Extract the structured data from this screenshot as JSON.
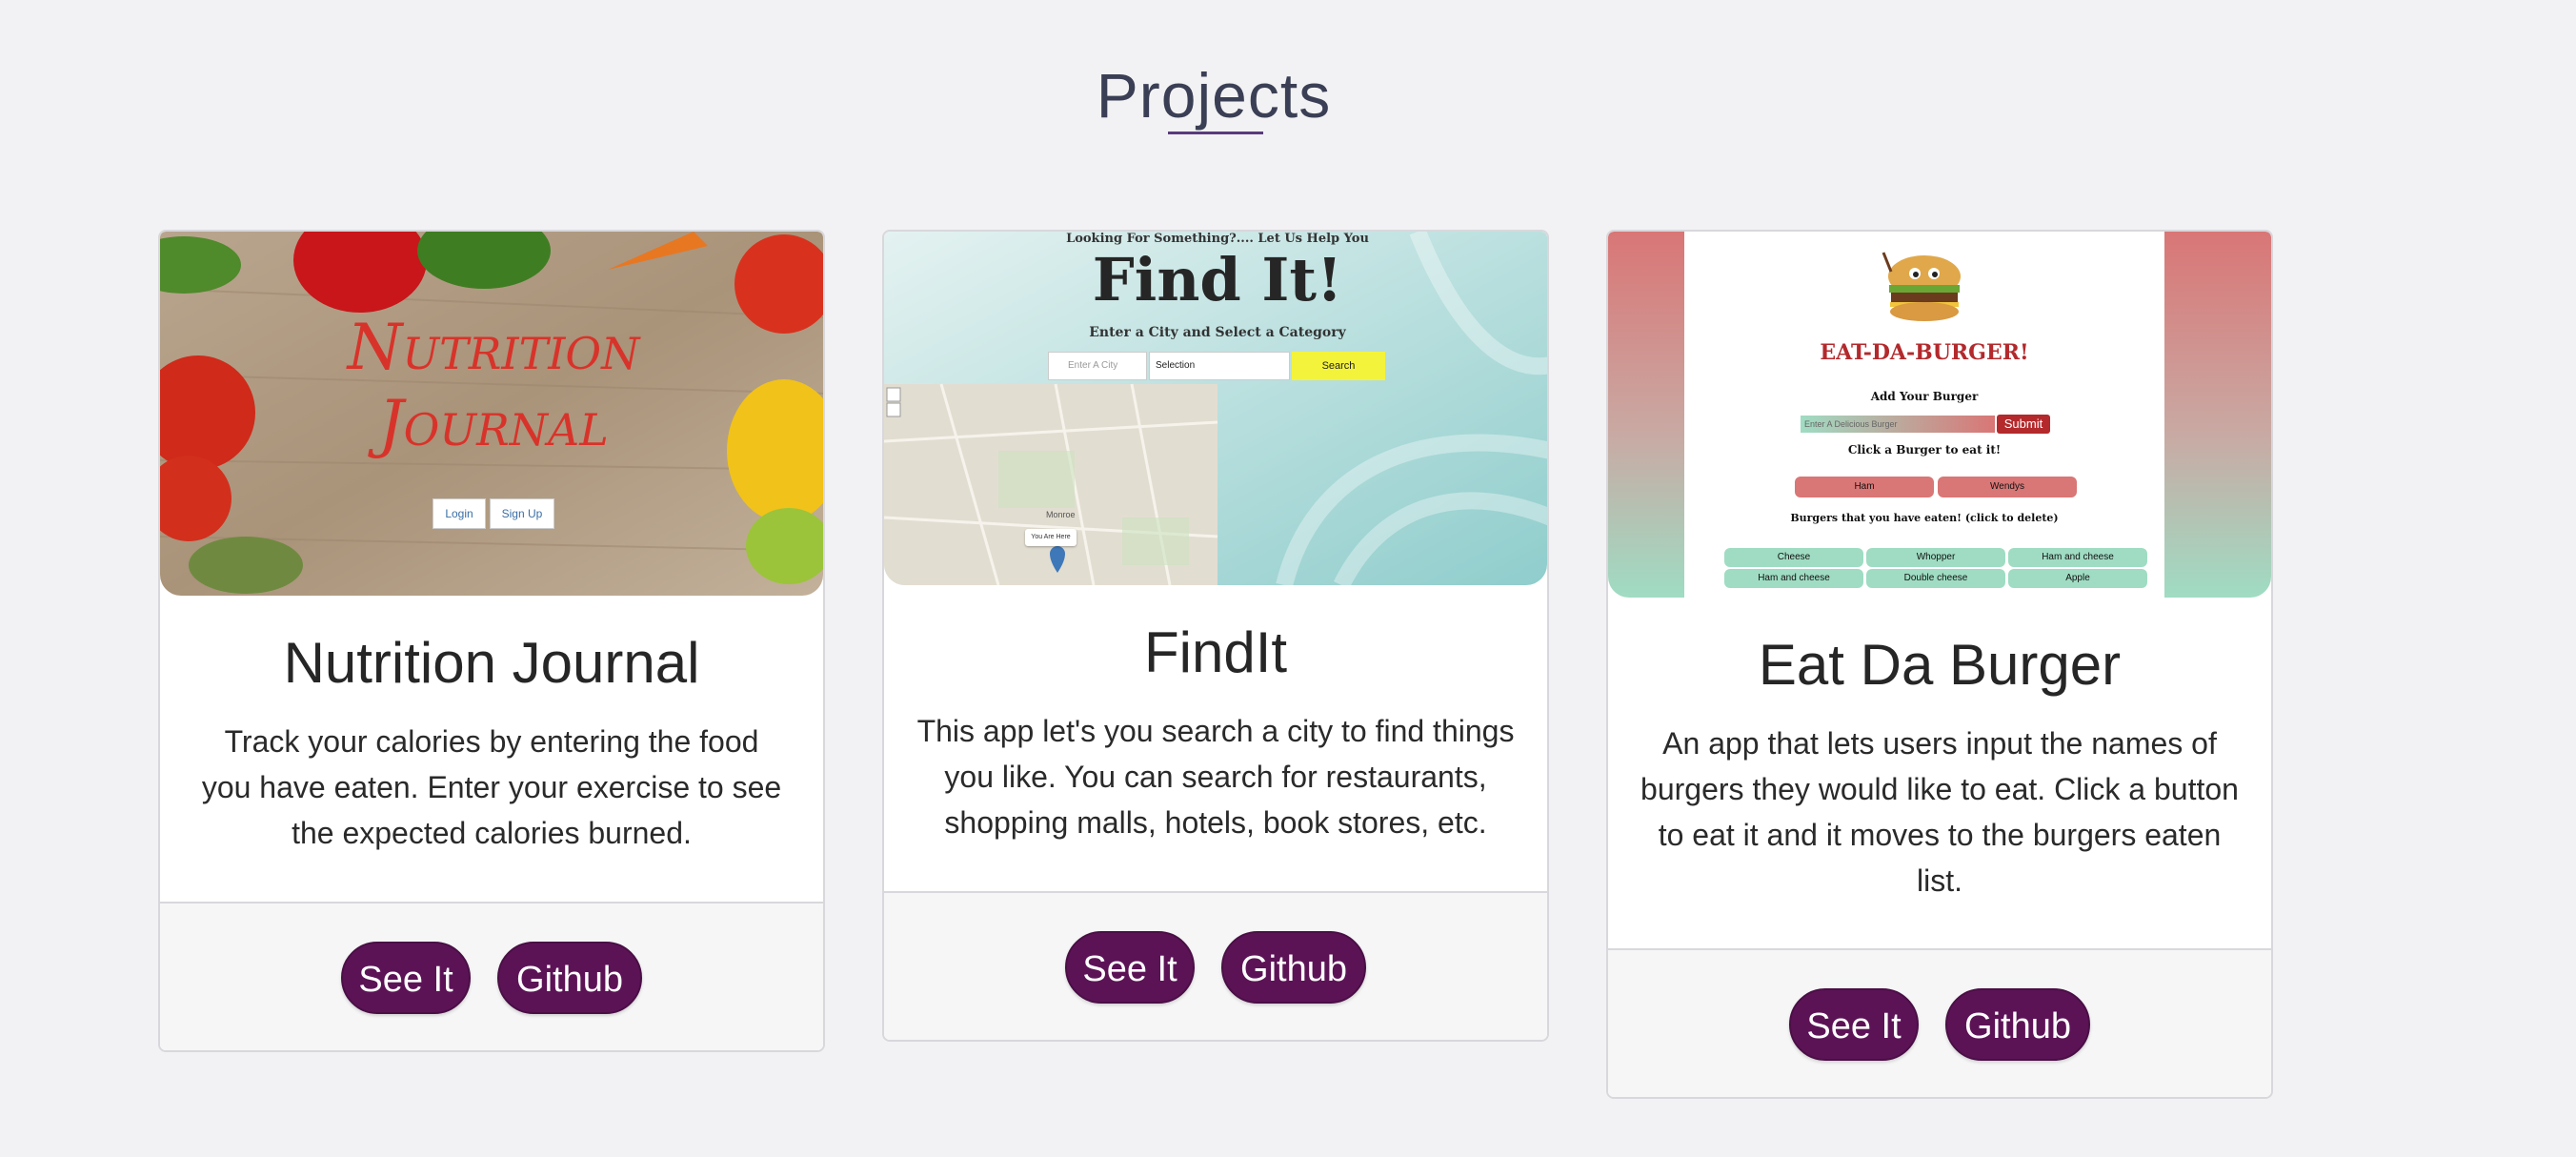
{
  "section": {
    "title": "Projects"
  },
  "projects": [
    {
      "title": "Nutrition Journal",
      "description": "Track your calories by entering the food you have eaten. Enter your exercise to see the expected calories burned.",
      "see_it": "See It",
      "github": "Github",
      "preview": {
        "logo_line1": "Nutrition",
        "logo_line2": "Journal",
        "login": "Login",
        "signup": "Sign Up"
      }
    },
    {
      "title": "FindIt",
      "description": "This app let's you search a city to find things you like. You can search for restaurants, shopping malls, hotels, book stores, etc.",
      "see_it": "See It",
      "github": "Github",
      "preview": {
        "tagline": "Looking For Something?.... Let Us Help You",
        "headline": "Find It!",
        "subline": "Enter a City and Select a Category",
        "city_placeholder": "Enter A City",
        "selection": "Selection",
        "search": "Search",
        "marker": "You Are Here",
        "map_town": "Monroe"
      }
    },
    {
      "title": "Eat Da Burger",
      "description": "An app that lets users input the names of burgers they would like to eat. Click a button to eat it and it moves to the burgers eaten list.",
      "see_it": "See It",
      "github": "Github",
      "preview": {
        "heading": "EAT-DA-BURGER!",
        "add_label": "Add Your Burger",
        "input_placeholder": "Enter A Delicious Burger",
        "submit": "Submit",
        "click_label": "Click a Burger to eat it!",
        "to_eat": [
          "Ham",
          "Wendys"
        ],
        "eaten_label": "Burgers that you have eaten! (click to delete)",
        "eaten": [
          "Cheese",
          "Whopper",
          "Ham and cheese",
          "Ham and cheese",
          "Double cheese",
          "Apple"
        ]
      }
    }
  ],
  "colors": {
    "button": "#5c1356",
    "accent_underline": "#5a3b7c",
    "burger_red": "#b3292c",
    "burger_green": "#9fdcc3"
  }
}
